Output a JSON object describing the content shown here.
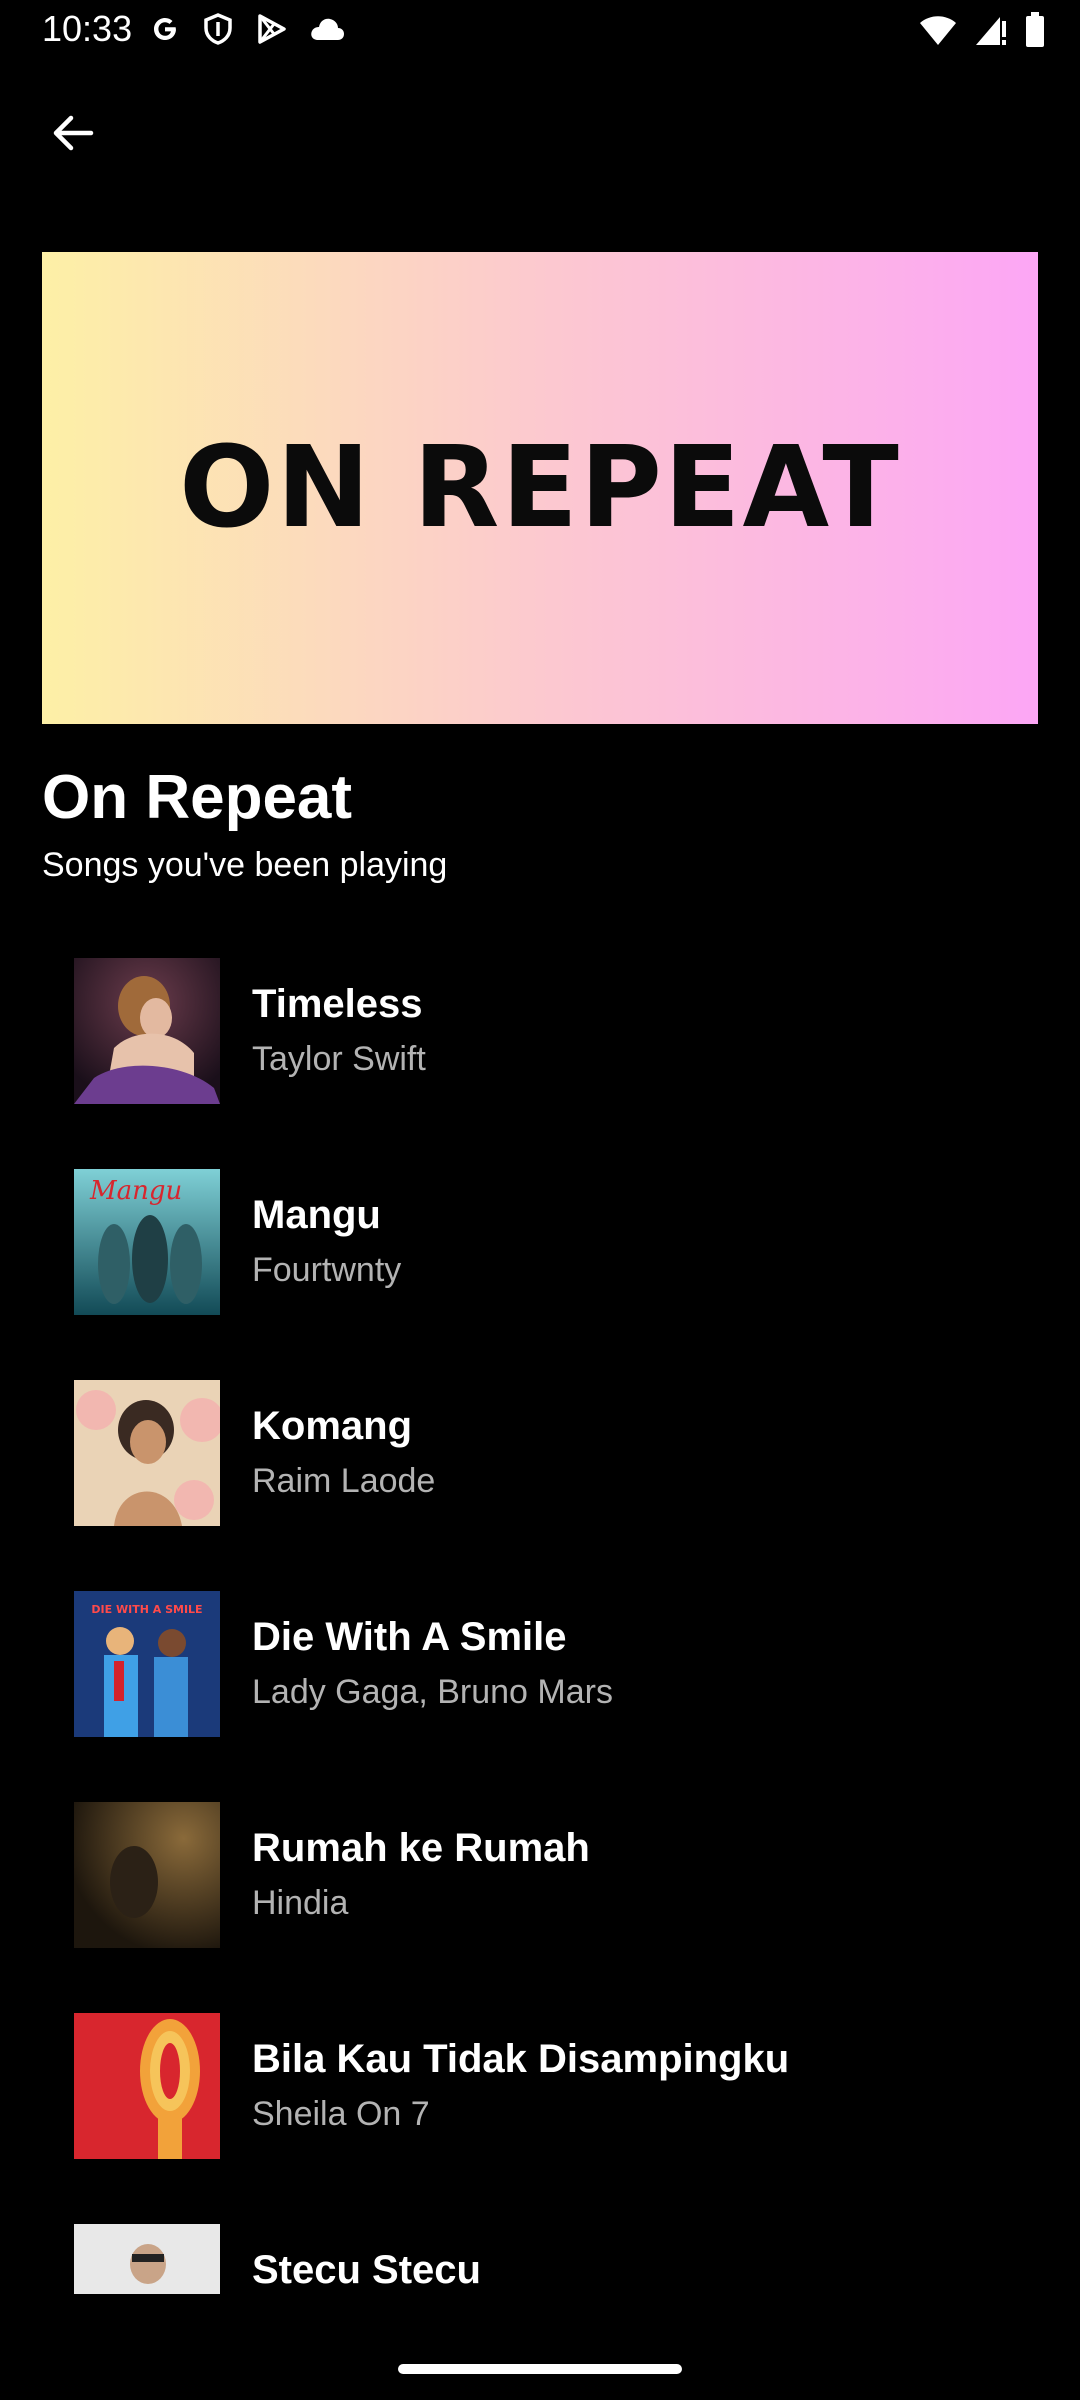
{
  "status_bar": {
    "time": "10:33",
    "left_icons": [
      "google-icon",
      "shield-icon",
      "play-store-icon",
      "cloud-icon"
    ],
    "right_icons": [
      "wifi-icon",
      "signal-icon",
      "battery-icon"
    ]
  },
  "header": {
    "back_icon": "arrow-left-icon"
  },
  "hero": {
    "text": "ON REPEAT",
    "gradient": [
      "#fdf0a6",
      "#fcc9cf",
      "#fca6f5"
    ]
  },
  "playlist": {
    "title": "On Repeat",
    "subtitle": "Songs you've been playing"
  },
  "tracks": [
    {
      "title": "Timeless",
      "artist": "Taylor Swift"
    },
    {
      "title": "Mangu",
      "artist": "Fourtwnty",
      "cover_text": "Mangu"
    },
    {
      "title": "Komang",
      "artist": "Raim Laode"
    },
    {
      "title": "Die With A Smile",
      "artist": "Lady Gaga, Bruno Mars",
      "cover_text": "DIE WITH A SMILE"
    },
    {
      "title": "Rumah ke Rumah",
      "artist": "Hindia"
    },
    {
      "title": "Bila Kau Tidak Disampingku",
      "artist": "Sheila On 7"
    },
    {
      "title": "Stecu Stecu",
      "artist": ""
    }
  ],
  "colors": {
    "background": "#000000",
    "text_primary": "#ffffff",
    "text_secondary": "#b3b3b3"
  }
}
